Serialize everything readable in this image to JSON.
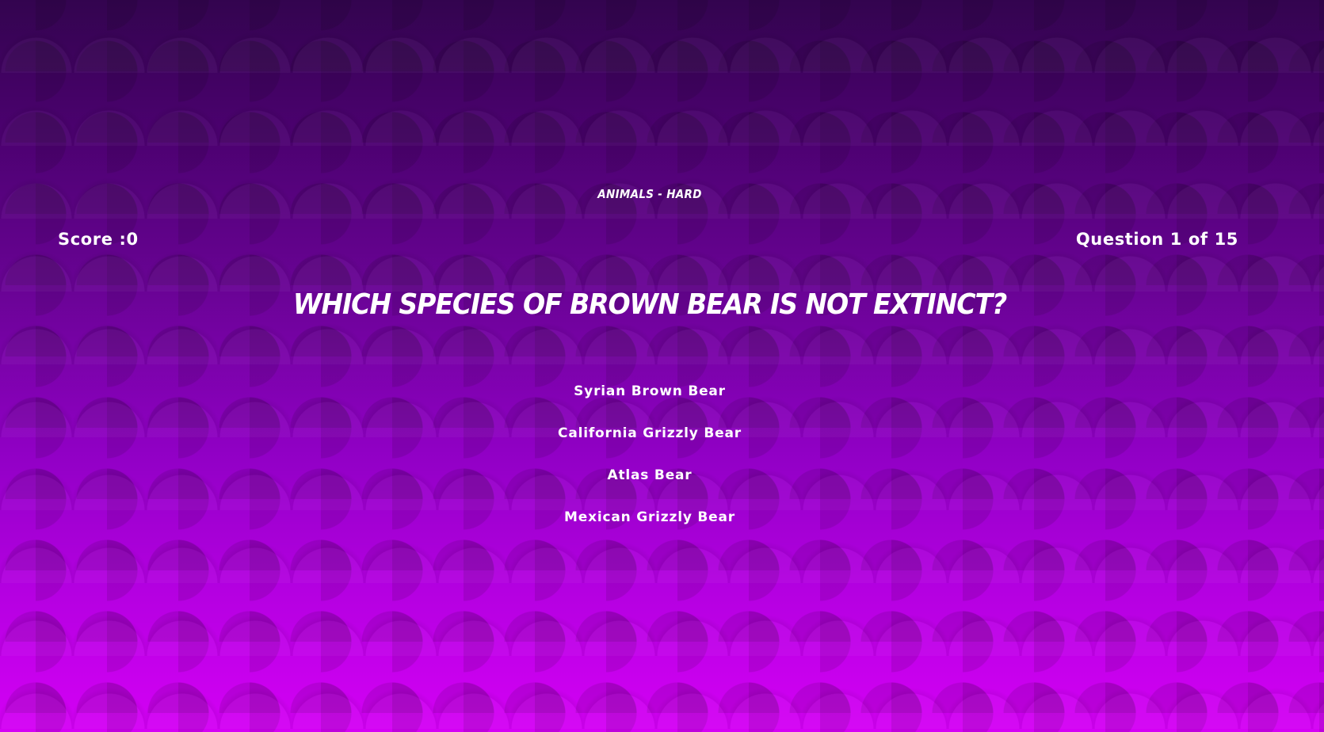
{
  "header": {
    "category": "ANIMALS - HARD",
    "score_label": "Score :",
    "score_value": "0",
    "question_word": "Question",
    "question_current": "1",
    "question_of": "of",
    "question_total": "15"
  },
  "question": {
    "text": "Which species of brown bear is not extinct?"
  },
  "answers": [
    {
      "label": "Syrian Brown Bear"
    },
    {
      "label": "California Grizzly Bear"
    },
    {
      "label": "Atlas Bear"
    },
    {
      "label": "Mexican Grizzly Bear"
    }
  ],
  "colors": {
    "background_top": "#33044f",
    "background_bottom": "#d400f5",
    "text": "#ffffff"
  }
}
